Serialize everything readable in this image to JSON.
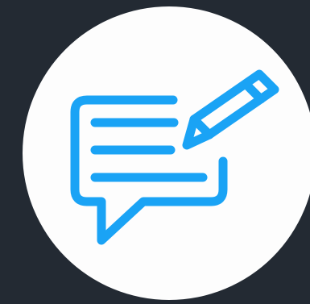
{
  "background_color": "#232a33",
  "circle_color": "#fdfdfd",
  "icon": {
    "name": "edit-message-icon",
    "color": "#1aa3f5"
  }
}
